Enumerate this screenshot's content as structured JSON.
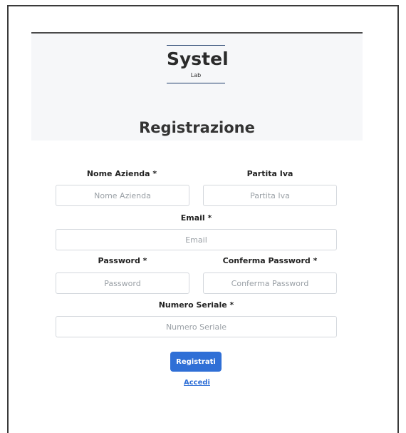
{
  "logo": {
    "title": "Systel",
    "subtitle": "Lab"
  },
  "page_title": "Registrazione",
  "form": {
    "company": {
      "label": "Nome Azienda *",
      "placeholder": "Nome Azienda",
      "value": ""
    },
    "vat": {
      "label": "Partita Iva",
      "placeholder": "Partita Iva",
      "value": ""
    },
    "email": {
      "label": "Email *",
      "placeholder": "Email",
      "value": ""
    },
    "password": {
      "label": "Password *",
      "placeholder": "Password",
      "value": ""
    },
    "confirm_password": {
      "label": "Conferma Password *",
      "placeholder": "Conferma Password",
      "value": ""
    },
    "serial": {
      "label": "Numero Seriale *",
      "placeholder": "Numero Seriale",
      "value": ""
    },
    "submit_label": "Registrati",
    "login_link": "Accedi"
  },
  "colors": {
    "primary": "#2f6fd6",
    "logo_accent": "#1f3d6b",
    "header_band": "#f6f7f9"
  }
}
